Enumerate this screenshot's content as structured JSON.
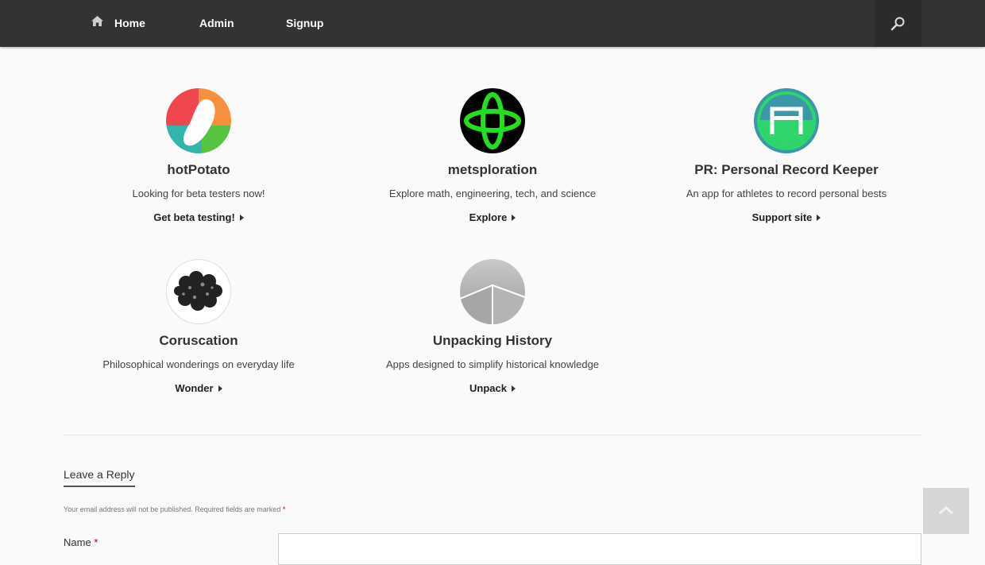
{
  "nav": {
    "home_label": "Home",
    "admin_label": "Admin",
    "signup_label": "Signup",
    "home_icon": "home-icon",
    "search_icon": "search-icon"
  },
  "apps": [
    {
      "title": "hotPotato",
      "description": "Looking for beta testers now!",
      "link": "Get beta testing!",
      "logo": "hotpotato-logo"
    },
    {
      "title": "metsploration",
      "description": "Explore math, engineering, tech, and science",
      "link": "Explore",
      "logo": "metsploration-logo"
    },
    {
      "title": "PR: Personal Record Keeper",
      "description": "An app for athletes to record personal bests",
      "link": "Support site",
      "logo": "pr-logo"
    },
    {
      "title": "Coruscation",
      "description": "Philosophical wonderings on everyday life",
      "link": "Wonder",
      "logo": "coruscation-logo"
    },
    {
      "title": "Unpacking History",
      "description": "Apps designed to simplify historical knowledge",
      "link": "Unpack",
      "logo": "unpacking-history-logo"
    }
  ],
  "reply": {
    "title": "Leave a Reply",
    "notes": "Your email address will not be published. Required fields are marked",
    "required_mark": "*",
    "name_label": "Name",
    "name_value": ""
  },
  "colors": {
    "topbar": "#333336",
    "background": "#fafafa",
    "required": "#bb0000"
  }
}
